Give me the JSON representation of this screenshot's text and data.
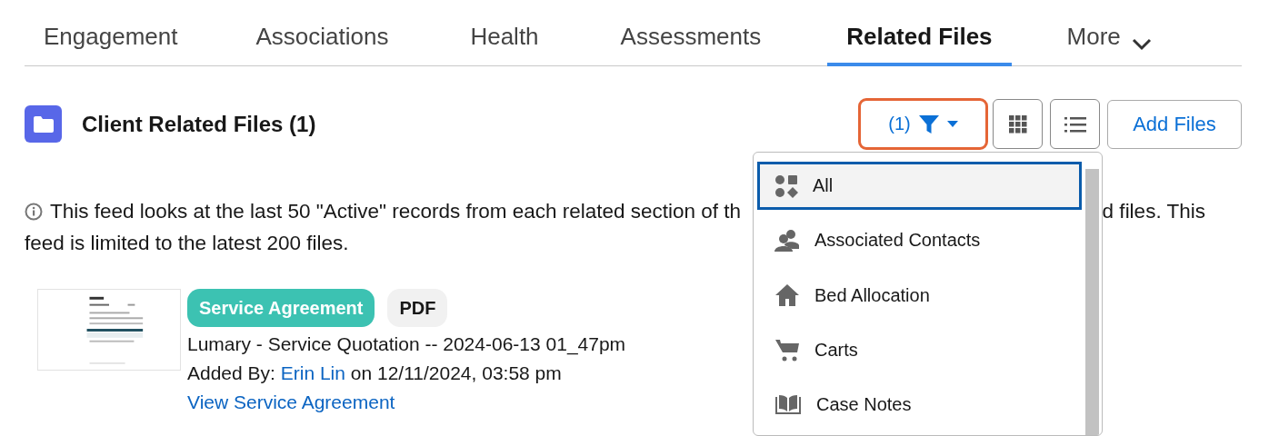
{
  "tabs": [
    {
      "label": "Engagement",
      "selected": false
    },
    {
      "label": "Associations",
      "selected": false
    },
    {
      "label": "Health",
      "selected": false
    },
    {
      "label": "Assessments",
      "selected": false
    },
    {
      "label": "Related Files",
      "selected": true
    },
    {
      "label": "More",
      "selected": false,
      "kind": "menu"
    }
  ],
  "header": {
    "title": "Client Related Files (1)",
    "filter_count": "(1)",
    "add_button": "Add Files"
  },
  "info": {
    "line_1_start": "This feed looks at the last 50 \"Active\" records from each related section of th",
    "line_1_end": "d files. This",
    "line_2": "feed is limited to the latest 200 files."
  },
  "files": [
    {
      "category": "Service Agreement",
      "file_type": "PDF",
      "name": "Lumary - Service Quotation -- 2024-06-13 01_47pm",
      "added_by_label": "Added By:",
      "added_by": "Erin Lin",
      "added_on": "on 12/11/2024, 03:58 pm",
      "link": "View Service Agreement"
    }
  ],
  "filter_menu": {
    "items": [
      {
        "label": "All",
        "kind": "shapes",
        "selected": true
      },
      {
        "label": "Associated Contacts",
        "kind": "people",
        "selected": false
      },
      {
        "label": "Bed Allocation",
        "kind": "home",
        "selected": false
      },
      {
        "label": "Carts",
        "kind": "cart",
        "selected": false
      },
      {
        "label": "Case Notes",
        "kind": "book",
        "selected": false
      }
    ]
  }
}
